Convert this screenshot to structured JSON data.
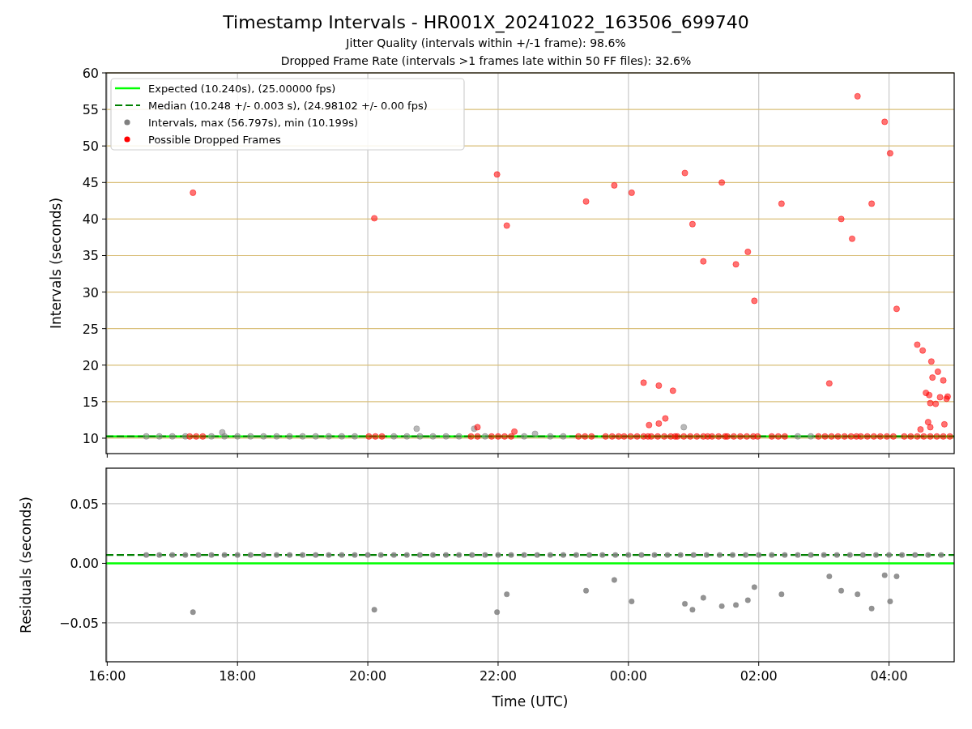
{
  "figure": {
    "title": "Timestamp Intervals - HR001X_20241022_163506_699740",
    "subtitles": [
      "Jitter Quality (intervals within +/-1 frame): 98.6%",
      "Dropped Frame Rate (intervals >1 frames late within 50 FF files): 32.6%"
    ]
  },
  "panels": [
    {
      "chart_data": {
        "type": "scatter",
        "grid": true,
        "legend": true,
        "ylabel": "Intervals (seconds)",
        "xlim": [
          "2024-10-22T15:59",
          "2024-10-23T05:00"
        ],
        "ylim": [
          7.89,
          60
        ],
        "yticks": [
          {
            "value": 10,
            "label": "10"
          },
          {
            "value": 15,
            "label": "15"
          },
          {
            "value": 20,
            "label": "20"
          },
          {
            "value": 25,
            "label": "25"
          },
          {
            "value": 30,
            "label": "30"
          },
          {
            "value": 35,
            "label": "35"
          },
          {
            "value": 40,
            "label": "40"
          },
          {
            "value": 45,
            "label": "45"
          },
          {
            "value": 50,
            "label": "50"
          },
          {
            "value": 55,
            "label": "55"
          },
          {
            "value": 60,
            "label": "60"
          }
        ],
        "series": [
          {
            "name": "Expected (10.240s), (25.00000 fps)",
            "type": "line",
            "color": "#00ff00",
            "x": [
              "2024-10-22T15:59",
              "2024-10-23T05:00"
            ],
            "values": [
              10.24,
              10.24
            ]
          },
          {
            "name": "Median (10.248 +/- 0.003 s), (24.98102 +/- 0.00 fps)",
            "type": "line",
            "line_style": "dashed",
            "color": "#008000",
            "x": [
              "2024-10-22T15:59",
              "2024-10-23T05:00"
            ],
            "values": [
              10.248,
              10.248
            ]
          },
          {
            "name": "Intervals, max (56.797s), min (10.199s)",
            "type": "scatter",
            "color": "#808080",
            "x": [
              "2024-10-22T16:36",
              "2024-10-22T16:48",
              "2024-10-22T17:00",
              "2024-10-22T17:12",
              "2024-10-22T17:36",
              "2024-10-22T17:48",
              "2024-10-22T18:00",
              "2024-10-22T18:12",
              "2024-10-22T18:24",
              "2024-10-22T18:36",
              "2024-10-22T18:48",
              "2024-10-22T19:00",
              "2024-10-22T19:12",
              "2024-10-22T19:24",
              "2024-10-22T19:36",
              "2024-10-22T19:48",
              "2024-10-22T20:24",
              "2024-10-22T20:36",
              "2024-10-22T20:48",
              "2024-10-22T21:00",
              "2024-10-22T21:12",
              "2024-10-22T21:24",
              "2024-10-22T21:48",
              "2024-10-22T22:24",
              "2024-10-22T22:48",
              "2024-10-22T23:00",
              "2024-10-23T02:36",
              "2024-10-23T02:48",
              "2024-10-22T17:46",
              "2024-10-22T20:45",
              "2024-10-22T21:38",
              "2024-10-22T22:34",
              "2024-10-23T00:51"
            ],
            "values": [
              10.25,
              10.25,
              10.25,
              10.25,
              10.25,
              10.25,
              10.25,
              10.25,
              10.25,
              10.25,
              10.25,
              10.25,
              10.25,
              10.25,
              10.25,
              10.25,
              10.25,
              10.25,
              10.25,
              10.25,
              10.25,
              10.25,
              10.25,
              10.25,
              10.25,
              10.25,
              10.25,
              10.25,
              10.8,
              11.3,
              11.3,
              10.6,
              11.5
            ]
          },
          {
            "name": "Possible Dropped Frames",
            "type": "scatter",
            "color": "#ff0000",
            "x": [
              "2024-10-22T17:16",
              "2024-10-22T17:22",
              "2024-10-22T17:28",
              "2024-10-22T20:01",
              "2024-10-22T20:07",
              "2024-10-22T20:13",
              "2024-10-22T21:35",
              "2024-10-22T21:41",
              "2024-10-22T21:54",
              "2024-10-22T22:00",
              "2024-10-22T22:06",
              "2024-10-22T22:12",
              "2024-10-22T23:14",
              "2024-10-22T23:20",
              "2024-10-22T23:26",
              "2024-10-22T23:39",
              "2024-10-22T23:45",
              "2024-10-22T23:51",
              "2024-10-22T23:56",
              "2024-10-23T00:02",
              "2024-10-23T00:08",
              "2024-10-23T00:14",
              "2024-10-23T00:18",
              "2024-10-23T00:21",
              "2024-10-23T00:27",
              "2024-10-23T00:33",
              "2024-10-23T00:39",
              "2024-10-23T00:43",
              "2024-10-23T00:45",
              "2024-10-23T00:51",
              "2024-10-23T00:57",
              "2024-10-23T01:03",
              "2024-10-23T01:09",
              "2024-10-23T01:13",
              "2024-10-23T01:17",
              "2024-10-23T01:23",
              "2024-10-23T01:29",
              "2024-10-23T01:31",
              "2024-10-23T01:37",
              "2024-10-23T01:43",
              "2024-10-23T01:49",
              "2024-10-23T01:55",
              "2024-10-23T01:59",
              "2024-10-23T02:12",
              "2024-10-23T02:18",
              "2024-10-23T02:24",
              "2024-10-23T02:55",
              "2024-10-23T03:01",
              "2024-10-23T03:07",
              "2024-10-23T03:13",
              "2024-10-23T03:19",
              "2024-10-23T03:25",
              "2024-10-23T03:30",
              "2024-10-23T03:34",
              "2024-10-23T03:40",
              "2024-10-23T03:46",
              "2024-10-23T03:52",
              "2024-10-23T03:58",
              "2024-10-23T04:04",
              "2024-10-23T04:14",
              "2024-10-23T04:20",
              "2024-10-23T04:26",
              "2024-10-23T04:32",
              "2024-10-23T04:38",
              "2024-10-23T04:44",
              "2024-10-23T04:50",
              "2024-10-23T04:56",
              "2024-10-22T17:19",
              "2024-10-22T20:06",
              "2024-10-22T21:41",
              "2024-10-22T21:59",
              "2024-10-22T22:08",
              "2024-10-22T22:15",
              "2024-10-22T23:21",
              "2024-10-22T23:47",
              "2024-10-23T00:03",
              "2024-10-23T00:14",
              "2024-10-23T00:19",
              "2024-10-23T00:28",
              "2024-10-23T00:28",
              "2024-10-23T00:34",
              "2024-10-23T00:41",
              "2024-10-23T00:52",
              "2024-10-23T00:59",
              "2024-10-23T01:09",
              "2024-10-23T01:26",
              "2024-10-23T01:39",
              "2024-10-23T01:50",
              "2024-10-23T01:56",
              "2024-10-23T02:21",
              "2024-10-23T03:05",
              "2024-10-23T03:16",
              "2024-10-23T03:26",
              "2024-10-23T03:31",
              "2024-10-23T03:44",
              "2024-10-23T03:56",
              "2024-10-23T04:01",
              "2024-10-23T04:07",
              "2024-10-23T04:26",
              "2024-10-23T04:31",
              "2024-10-23T04:39",
              "2024-10-23T04:45",
              "2024-10-23T04:50",
              "2024-10-23T04:47",
              "2024-10-23T04:53",
              "2024-10-23T04:54",
              "2024-10-23T04:34",
              "2024-10-23T04:37",
              "2024-10-23T04:40",
              "2024-10-23T04:38",
              "2024-10-23T04:43",
              "2024-10-23T04:36",
              "2024-10-23T04:38",
              "2024-10-23T04:51",
              "2024-10-23T04:29"
            ],
            "values": [
              10.24,
              10.24,
              10.24,
              10.24,
              10.24,
              10.24,
              10.24,
              10.24,
              10.24,
              10.24,
              10.24,
              10.24,
              10.24,
              10.24,
              10.24,
              10.24,
              10.24,
              10.24,
              10.24,
              10.24,
              10.24,
              10.24,
              10.24,
              10.24,
              10.24,
              10.24,
              10.24,
              10.24,
              10.24,
              10.24,
              10.24,
              10.24,
              10.24,
              10.24,
              10.24,
              10.24,
              10.24,
              10.24,
              10.24,
              10.24,
              10.24,
              10.24,
              10.24,
              10.24,
              10.24,
              10.24,
              10.24,
              10.24,
              10.24,
              10.24,
              10.24,
              10.24,
              10.24,
              10.24,
              10.24,
              10.24,
              10.24,
              10.24,
              10.24,
              10.24,
              10.24,
              10.24,
              10.24,
              10.24,
              10.24,
              10.24,
              10.24,
              43.6,
              40.1,
              11.5,
              46.1,
              39.1,
              10.9,
              42.4,
              44.6,
              43.6,
              17.6,
              11.8,
              12.0,
              17.2,
              12.7,
              16.5,
              46.3,
              39.3,
              34.2,
              45.0,
              33.8,
              35.5,
              28.8,
              42.1,
              17.5,
              40.0,
              37.3,
              56.8,
              42.1,
              53.3,
              49.0,
              27.7,
              22.8,
              22.0,
              20.5,
              19.1,
              17.9,
              15.6,
              15.4,
              15.7,
              16.2,
              15.9,
              18.3,
              14.8,
              14.7,
              12.2,
              11.5,
              11.9,
              11.2
            ]
          }
        ]
      }
    },
    {
      "chart_data": {
        "type": "scatter",
        "grid": true,
        "xlabel": "Time (UTC)",
        "ylabel": "Residuals (seconds)",
        "xlim": [
          "2024-10-22T15:59",
          "2024-10-23T05:00"
        ],
        "ylim": [
          -0.0827,
          0.0799
        ],
        "xticks": [
          {
            "value": "2024-10-22T16:00",
            "label": "16:00"
          },
          {
            "value": "2024-10-22T18:00",
            "label": "18:00"
          },
          {
            "value": "2024-10-22T20:00",
            "label": "20:00"
          },
          {
            "value": "2024-10-22T22:00",
            "label": "22:00"
          },
          {
            "value": "2024-10-23T00:00",
            "label": "00:00"
          },
          {
            "value": "2024-10-23T02:00",
            "label": "02:00"
          },
          {
            "value": "2024-10-23T04:00",
            "label": "04:00"
          }
        ],
        "yticks": [
          {
            "value": -0.05,
            "label": "−0.05"
          },
          {
            "value": 0,
            "label": "0.00"
          },
          {
            "value": 0.05,
            "label": "0.05"
          }
        ],
        "series": [
          {
            "type": "line",
            "color": "#00ff00",
            "x": [
              "2024-10-22T15:59",
              "2024-10-23T05:00"
            ],
            "values": [
              0,
              0
            ]
          },
          {
            "type": "line",
            "line_style": "dashed",
            "color": "#008000",
            "x": [
              "2024-10-22T15:59",
              "2024-10-23T05:00"
            ],
            "values": [
              0.007,
              0.007
            ]
          },
          {
            "type": "scatter",
            "color": "#808080",
            "x": [
              "2024-10-22T16:36",
              "2024-10-22T16:48",
              "2024-10-22T17:00",
              "2024-10-22T17:12",
              "2024-10-22T17:24",
              "2024-10-22T17:36",
              "2024-10-22T17:48",
              "2024-10-22T18:00",
              "2024-10-22T18:12",
              "2024-10-22T18:24",
              "2024-10-22T18:36",
              "2024-10-22T18:48",
              "2024-10-22T19:00",
              "2024-10-22T19:12",
              "2024-10-22T19:24",
              "2024-10-22T19:36",
              "2024-10-22T19:48",
              "2024-10-22T20:00",
              "2024-10-22T20:12",
              "2024-10-22T20:24",
              "2024-10-22T20:36",
              "2024-10-22T20:48",
              "2024-10-22T21:00",
              "2024-10-22T21:12",
              "2024-10-22T21:24",
              "2024-10-22T21:36",
              "2024-10-22T21:48",
              "2024-10-22T22:00",
              "2024-10-22T22:12",
              "2024-10-22T22:24",
              "2024-10-22T22:36",
              "2024-10-22T22:48",
              "2024-10-22T23:00",
              "2024-10-22T23:12",
              "2024-10-22T23:24",
              "2024-10-22T23:36",
              "2024-10-22T23:48",
              "2024-10-23T00:00",
              "2024-10-23T00:12",
              "2024-10-23T00:24",
              "2024-10-23T00:36",
              "2024-10-23T00:48",
              "2024-10-23T01:00",
              "2024-10-23T01:12",
              "2024-10-23T01:24",
              "2024-10-23T01:36",
              "2024-10-23T01:48",
              "2024-10-23T02:00",
              "2024-10-23T02:12",
              "2024-10-23T02:24",
              "2024-10-23T02:36",
              "2024-10-23T02:48",
              "2024-10-23T03:00",
              "2024-10-23T03:12",
              "2024-10-23T03:24",
              "2024-10-23T03:36",
              "2024-10-23T03:48",
              "2024-10-23T04:00",
              "2024-10-23T04:12",
              "2024-10-23T04:24",
              "2024-10-23T04:36",
              "2024-10-23T04:48",
              "2024-10-22T17:19",
              "2024-10-22T20:06",
              "2024-10-22T21:59",
              "2024-10-22T22:08",
              "2024-10-22T23:21",
              "2024-10-22T23:47",
              "2024-10-23T00:03",
              "2024-10-23T00:52",
              "2024-10-23T00:59",
              "2024-10-23T01:09",
              "2024-10-23T01:26",
              "2024-10-23T01:39",
              "2024-10-23T01:50",
              "2024-10-23T01:56",
              "2024-10-23T02:21",
              "2024-10-23T03:05",
              "2024-10-23T03:16",
              "2024-10-23T03:31",
              "2024-10-23T03:44",
              "2024-10-23T03:56",
              "2024-10-23T04:01",
              "2024-10-23T04:07"
            ],
            "values": [
              0.007,
              0.007,
              0.007,
              0.007,
              0.007,
              0.007,
              0.007,
              0.007,
              0.007,
              0.007,
              0.007,
              0.007,
              0.007,
              0.007,
              0.007,
              0.007,
              0.007,
              0.007,
              0.007,
              0.007,
              0.007,
              0.007,
              0.007,
              0.007,
              0.007,
              0.007,
              0.007,
              0.007,
              0.007,
              0.007,
              0.007,
              0.007,
              0.007,
              0.007,
              0.007,
              0.007,
              0.007,
              0.007,
              0.007,
              0.007,
              0.007,
              0.007,
              0.007,
              0.007,
              0.007,
              0.007,
              0.007,
              0.007,
              0.007,
              0.007,
              0.007,
              0.007,
              0.007,
              0.007,
              0.007,
              0.007,
              0.007,
              0.007,
              0.007,
              0.007,
              0.007,
              0.007,
              -0.041,
              -0.039,
              -0.041,
              -0.026,
              -0.023,
              -0.014,
              -0.032,
              -0.034,
              -0.039,
              -0.029,
              -0.036,
              -0.035,
              -0.031,
              -0.02,
              -0.026,
              -0.011,
              -0.023,
              -0.026,
              -0.038,
              -0.01,
              -0.032,
              -0.011
            ]
          }
        ]
      }
    }
  ]
}
